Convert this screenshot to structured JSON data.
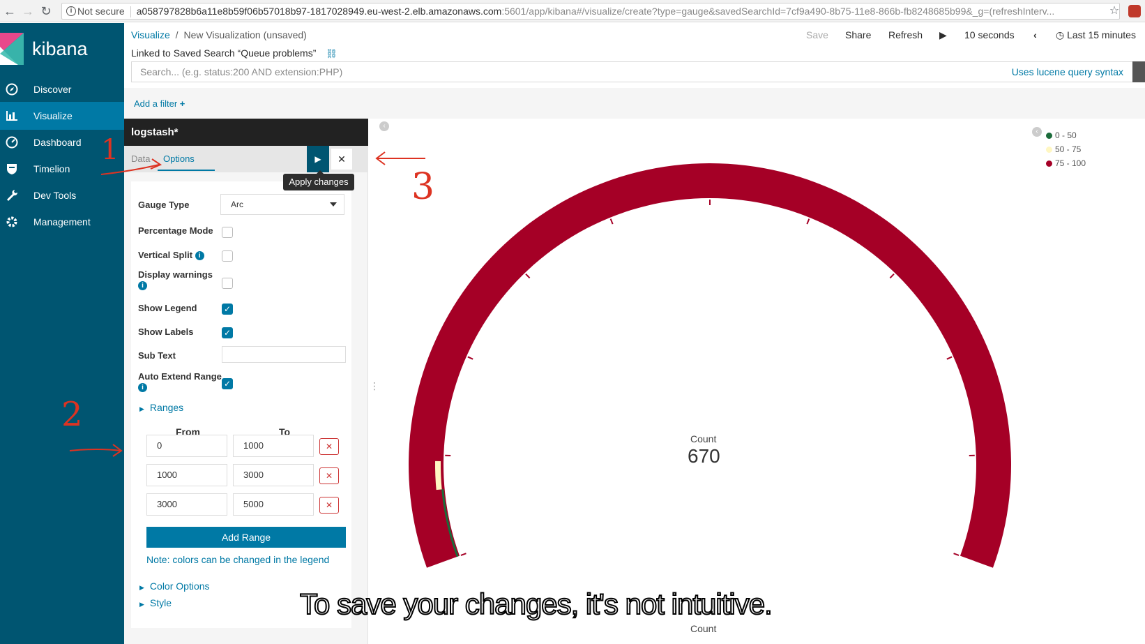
{
  "browser": {
    "security_label": "Not secure",
    "url_host": "a058797828b6a11e8b59f06b57018b97-1817028949.eu-west-2.elb.amazonaws.com",
    "url_rest": ":5601/app/kibana#/visualize/create?type=gauge&savedSearchId=7cf9a490-8b75-11e8-866b-fb8248685b99&_g=(refreshInterv..."
  },
  "sidebar": {
    "brand": "kibana",
    "items": [
      {
        "label": "Discover",
        "icon": "compass-icon"
      },
      {
        "label": "Visualize",
        "icon": "bar-chart-icon"
      },
      {
        "label": "Dashboard",
        "icon": "dashboard-icon"
      },
      {
        "label": "Timelion",
        "icon": "shield-icon"
      },
      {
        "label": "Dev Tools",
        "icon": "wrench-icon"
      },
      {
        "label": "Management",
        "icon": "gear-icon"
      }
    ],
    "active": "Visualize"
  },
  "header": {
    "breadcrumb_root": "Visualize",
    "breadcrumb_sep": "/",
    "breadcrumb_current": "New Visualization (unsaved)",
    "linked_search": "Linked to Saved Search “Queue problems”",
    "save": "Save",
    "share": "Share",
    "refresh": "Refresh",
    "interval": "10 seconds",
    "time_range": "Last 15 minutes"
  },
  "query": {
    "placeholder": "Search... (e.g. status:200 AND extension:PHP)",
    "syntax_link": "Uses lucene query syntax"
  },
  "filters": {
    "add_filter": "Add a filter"
  },
  "editor": {
    "index": "logstash*",
    "tabs": [
      "Data",
      "Options"
    ],
    "tooltip": "Apply changes",
    "options": {
      "gauge_type_label": "Gauge Type",
      "gauge_type_value": "Arc",
      "percentage_mode": "Percentage Mode",
      "vertical_split": "Vertical Split",
      "display_warnings": "Display warnings",
      "show_legend": "Show Legend",
      "show_labels": "Show Labels",
      "sub_text": "Sub Text",
      "auto_extend": "Auto Extend Range",
      "checked": {
        "percentage_mode": false,
        "vertical_split": false,
        "display_warnings": false,
        "show_legend": true,
        "show_labels": true,
        "auto_extend": true
      }
    },
    "ranges": {
      "title": "Ranges",
      "from_header": "From",
      "to_header": "To",
      "rows": [
        {
          "from": "0",
          "to": "1000"
        },
        {
          "from": "1000",
          "to": "3000"
        },
        {
          "from": "3000",
          "to": "5000"
        }
      ],
      "add_button": "Add Range",
      "note": "Note: colors can be changed in the legend"
    },
    "color_options": "Color Options",
    "style": "Style"
  },
  "gauge": {
    "label": "Count",
    "value": "670",
    "bottom_label": "Count",
    "legend": [
      {
        "label": "0 - 50",
        "color": "#1b6b3a"
      },
      {
        "label": "50 - 75",
        "color": "#fff7c2"
      },
      {
        "label": "75 - 100",
        "color": "#a50026"
      }
    ],
    "arc_color": "#a50026",
    "ranges_max": 5000,
    "value_number": 670
  },
  "annotations": {
    "one": "1",
    "two": "2",
    "three": "3"
  },
  "caption": "To save your changes, it's not intuitive."
}
